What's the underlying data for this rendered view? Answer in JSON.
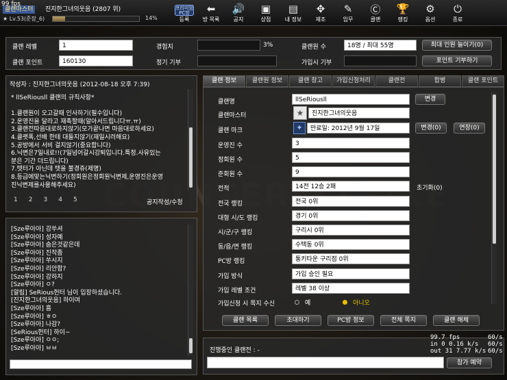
{
  "overlay": {
    "fps": "99 fps"
  },
  "profile": {
    "clan_tag": "클랜마스터",
    "name": "진지한그녀의웃음 (2807 위)",
    "level": "★ Lv.53(준장_6)",
    "exp_percent": 14,
    "exp_text": "14%"
  },
  "nav": [
    {
      "icon": "pc-room-badge",
      "label": "등록",
      "badge": "프리미엄 PC방"
    },
    {
      "icon": "arrow-left-icon",
      "label": "방 목록"
    },
    {
      "icon": "speaker-icon",
      "label": "공지"
    },
    {
      "icon": "shop-icon",
      "label": "상점"
    },
    {
      "icon": "profile-card-icon",
      "label": "내 정보"
    },
    {
      "icon": "wrench-icon",
      "label": "제조"
    },
    {
      "icon": "mission-icon",
      "label": "임무"
    },
    {
      "icon": "clan-icon",
      "label": "클랜"
    },
    {
      "icon": "trophy-icon",
      "label": "랭킹"
    },
    {
      "icon": "gear-icon",
      "label": "옵션"
    },
    {
      "icon": "power-icon",
      "label": "종료"
    }
  ],
  "info": {
    "clan_level_label": "클랜 레벨",
    "clan_level": "1",
    "exp_label": "경험치",
    "exp_pct": "3%",
    "members_label": "클랜원 수",
    "members": "18명 / 최대 55명",
    "increase_btn": "최대 인원 늘이기(0)",
    "points_label": "클랜 포인트",
    "points": "160130",
    "fee_label": "정기 기부",
    "join_fee_label": "가입시 기부",
    "donate_btn": "포인트 기부하기"
  },
  "notice": {
    "header": "작성자 : 진지한그녀의웃음 (2012-08-18 오후 7:39)",
    "body": "* llSeRiousll 클랜의 규칙사항*\n\n1.클랜원이 오고갈때 인사하기(필수입니다)\n2.운영진을 달라고 재촉할때(알아서드립니다ㅠ.ㅠ)\n3.클랜전따음대로하지않기(모가끝나면 마음대로하세요)\n4.클랫폭,선배 한테 대들지않기(재일시러해요)\n5.공방에서 서비 걸지않기(중요합니다)\n6.닉변은7일내로!!(7일넘어갈시강퇴입니다.특정.사유있는\n분은 기간 더드립니다)\n7.텟터가 아닌데 텟을 불경쥬(제명)\n8.등급에맞는닉변하기(정회원은정회원닉변제,운영진은운영\n진닉변제를사용해주세요)",
    "pages": [
      "1",
      "2",
      "3",
      "4",
      "5"
    ],
    "write_btn": "공지작성/수정"
  },
  "chat": {
    "lines": [
      "[Sze루아아] 강쑤셔",
      "[Sze루아아] 성자예",
      "[Sze루아아] 숨은것같은데",
      "[Sze루아아] 진작좀",
      "[Sze루아아] 쑤시지",
      "[Sze루아아] 리안함?",
      "[Sze루아아] 강하지",
      "[Sze루아아] ㅇ?",
      "[알림] SeRious헌터 님이 입장하셨습니다.",
      "[진지한그녀의웃음] 하이여",
      "[Sze루아아] 흠",
      "[Sze루아아] ㅎㅇ",
      "[Sze루아아] 나감?",
      "[SeRious헌터] 하이~",
      "[Sze루아아] ㅇㅇ;",
      "[Sze루아아] ㅂㅂ"
    ]
  },
  "tabs": [
    "클랜 정보",
    "클랜원 정보",
    "클랜 창고",
    "가입신청처리",
    "클랜전",
    "합병",
    "클랜 포인트"
  ],
  "clan": {
    "name_label": "클랜명",
    "name": "llSeRiousll",
    "change_btn": "변경",
    "master_label": "클랜마스터",
    "master": "진지한그녀의웃음",
    "mark_label": "클랜 마크",
    "mark_expire": "만료일: 2012년  9월 17일",
    "mark_change_btn": "변경(0)",
    "mark_extend_btn": "연장(0)",
    "staff_label": "운영진 수",
    "staff": "3",
    "regular_label": "정회원 수",
    "regular": "5",
    "associate_label": "준회원 수",
    "associate": "9",
    "record_label": "전적",
    "record": "14전 12승 2패",
    "reset_btn": "초기화(0)",
    "national_label": "전국 랭킹",
    "national": "전국      0위",
    "city_label": "대형 시/도 랭킹",
    "city": "경기      0위",
    "district_label": "시/군/구 랭킹",
    "district": "구리시      0위",
    "town_label": "동/읍/면 랭킹",
    "town": "수택동      0위",
    "pc_label": "PC방 랭킹",
    "pc": "통키타운 구리점      0위",
    "join_method_label": "가입 방식",
    "join_method": "가입 승인 필요",
    "join_level_label": "가입 레벨 조건",
    "join_level": "레벨 38 이상",
    "join_note_label": "가입신청 시 쪽지 수신",
    "opt_yes": "예",
    "opt_no": "아니오"
  },
  "actions": [
    "클랜 목록",
    "초대하기",
    "PC방 정보",
    "전체 쪽지",
    "클랜 해체"
  ],
  "progress": {
    "title": "진행중인 클랜전 : -",
    "join_btn": "참가 예약"
  },
  "net": {
    "l1": "99.7 fps",
    "l2": "in    0 0.16 k/s",
    "l3": "out  31 7.77 k/s",
    "r1": "60/s",
    "r2": "60/s",
    "r3": "60/s"
  }
}
